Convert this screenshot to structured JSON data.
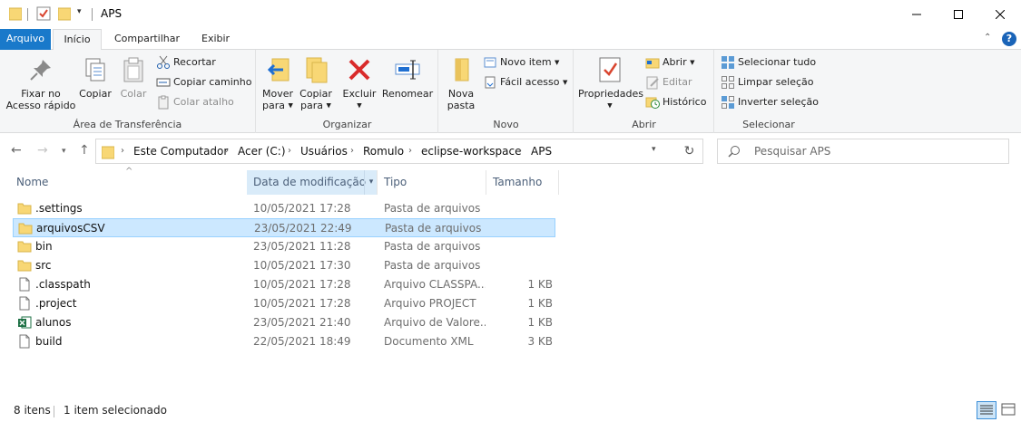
{
  "window": {
    "title": "APS"
  },
  "ribbon_tabs": {
    "file": "Arquivo",
    "home": "Início",
    "share": "Compartilhar",
    "view": "Exibir"
  },
  "clipboard": {
    "group_label": "Área de Transferência",
    "pin_line1": "Fixar no",
    "pin_line2": "Acesso rápido",
    "copy": "Copiar",
    "paste": "Colar",
    "cut": "Recortar",
    "copy_path": "Copiar caminho",
    "paste_shortcut": "Colar atalho"
  },
  "organize": {
    "group_label": "Organizar",
    "move_line1": "Mover",
    "move_line2": "para",
    "copy_line1": "Copiar",
    "copy_line2": "para",
    "delete": "Excluir",
    "rename": "Renomear"
  },
  "new": {
    "group_label": "Novo",
    "new_folder_line1": "Nova",
    "new_folder_line2": "pasta",
    "new_item": "Novo item",
    "easy_access": "Fácil acesso"
  },
  "open": {
    "group_label": "Abrir",
    "properties": "Propriedades",
    "open": "Abrir",
    "edit": "Editar",
    "history": "Histórico"
  },
  "select": {
    "group_label": "Selecionar",
    "select_all": "Selecionar tudo",
    "select_none": "Limpar seleção",
    "invert": "Inverter seleção"
  },
  "address": {
    "crumbs": [
      "Este Computador",
      "Acer (C:)",
      "Usuários",
      "Romulo",
      "eclipse-workspace",
      "APS"
    ]
  },
  "search": {
    "placeholder": "Pesquisar APS"
  },
  "columns": {
    "name": "Nome",
    "date": "Data de modificação",
    "type": "Tipo",
    "size": "Tamanho"
  },
  "files": [
    {
      "name": ".settings",
      "date": "10/05/2021 17:28",
      "type": "Pasta de arquivos",
      "size": "",
      "icon": "folder-icon"
    },
    {
      "name": "arquivosCSV",
      "date": "23/05/2021 22:49",
      "type": "Pasta de arquivos",
      "size": "",
      "icon": "folder-icon"
    },
    {
      "name": "bin",
      "date": "23/05/2021 11:28",
      "type": "Pasta de arquivos",
      "size": "",
      "icon": "folder-icon"
    },
    {
      "name": "src",
      "date": "10/05/2021 17:30",
      "type": "Pasta de arquivos",
      "size": "",
      "icon": "folder-icon"
    },
    {
      "name": ".classpath",
      "date": "10/05/2021 17:28",
      "type": "Arquivo CLASSPA...",
      "size": "1 KB",
      "icon": "file-icon"
    },
    {
      "name": ".project",
      "date": "10/05/2021 17:28",
      "type": "Arquivo PROJECT",
      "size": "1 KB",
      "icon": "file-icon"
    },
    {
      "name": "alunos",
      "date": "23/05/2021 21:40",
      "type": "Arquivo de Valore...",
      "size": "1 KB",
      "icon": "excel-icon"
    },
    {
      "name": "build",
      "date": "22/05/2021 18:49",
      "type": "Documento XML",
      "size": "3 KB",
      "icon": "file-icon"
    }
  ],
  "selected_file": "arquivosCSV",
  "status": {
    "item_count": "8 itens",
    "selection": "1 item selecionado"
  },
  "colors": {
    "accent": "#1979ca",
    "selection_bg": "#cce8ff",
    "folder": "#f8d775"
  }
}
